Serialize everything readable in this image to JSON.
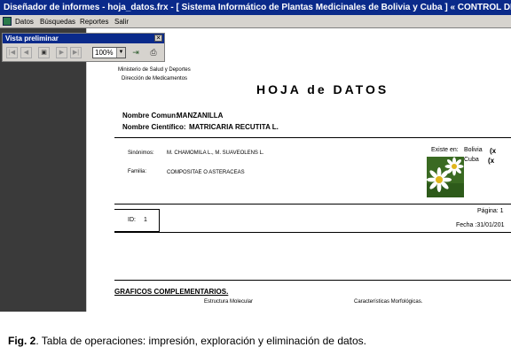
{
  "window": {
    "title": "Diseñador de informes - hoja_datos.frx - [ Sistema Informático de Plantas Medicinales de Bolivia y Cuba ]   « CONTROL DE DATOS  »"
  },
  "menu": [
    "Datos",
    "Búsquedas",
    "Reportes",
    "Salir"
  ],
  "preview_toolbar": {
    "title": "Vista preliminar",
    "close": "✕",
    "zoom": "100%"
  },
  "report": {
    "org_line1": "Ministerio de Salud y Deportes",
    "org_line2": "Dirección de Medicamentos",
    "heading": "HOJA de DATOS",
    "nombre_comun_label": "Nombre Comun:",
    "nombre_comun_value": "MANZANILLA",
    "nombre_cientifico_label": "Nombre Científico:",
    "nombre_cientifico_value": "MATRICARIA RECUTITA L.",
    "sinonimos_label": "Sinónimos:",
    "sinonimos_value": "M. CHAMOMILA L., M. SUAVEOLENS L.",
    "familia_label": "Familia:",
    "familia_value": "COMPOSITAE O ASTERACEAS",
    "existe_label": "Existe en:",
    "countries": [
      {
        "name": "Bolivia",
        "mark": "(x"
      },
      {
        "name": "Cuba",
        "mark": "(x"
      }
    ],
    "id_label": "ID:",
    "id_value": "1",
    "pagina": "Página: 1",
    "fecha": "Fecha :31/01/201",
    "graficos_title": "GRAFICOS COMPLEMENTARIOS.",
    "estructura": "Estructura Molecular",
    "caracteristicas": "Características Morfológicas."
  },
  "caption": {
    "bold": "Fig. 2",
    "text": ". Tabla de operaciones: impresión, exploración y eliminación de datos."
  }
}
